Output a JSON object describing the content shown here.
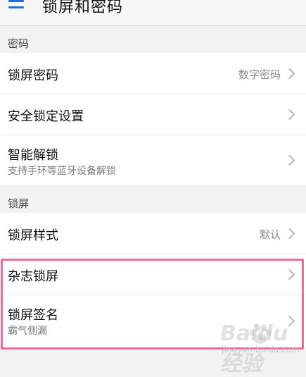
{
  "header": {
    "title": "锁屏和密码"
  },
  "sections": {
    "password": {
      "label": "密码"
    },
    "lockscreen": {
      "label": "锁屏"
    }
  },
  "rows": {
    "lock_password": {
      "title": "锁屏密码",
      "value": "数字密码"
    },
    "secure_lock": {
      "title": "安全锁定设置"
    },
    "smart_unlock": {
      "title": "智能解锁",
      "subtitle": "支持手环等蓝牙设备解锁"
    },
    "lock_style": {
      "title": "锁屏样式",
      "value": "默认"
    },
    "magazine_lock": {
      "title": "杂志锁屏"
    },
    "lock_signature": {
      "title": "锁屏签名",
      "subtitle": "霸气侧漏"
    }
  },
  "watermark": {
    "brand": "Baidu 经验",
    "url": "jingyan.baidu.com"
  },
  "colors": {
    "accent": "#1e6fd9",
    "highlight": "#f06aa0"
  }
}
